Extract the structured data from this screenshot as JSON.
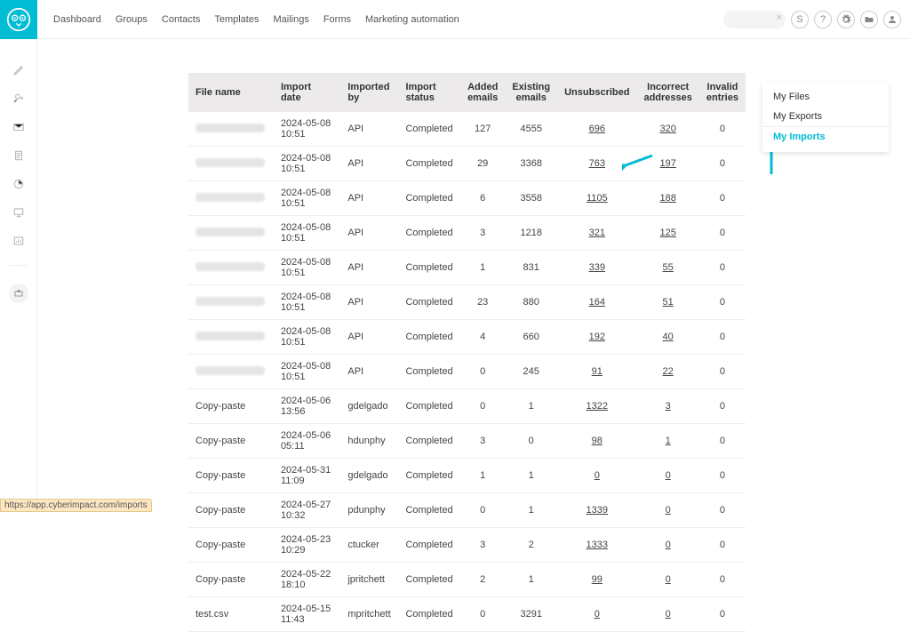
{
  "nav": [
    "Dashboard",
    "Groups",
    "Contacts",
    "Templates",
    "Mailings",
    "Forms",
    "Marketing automation"
  ],
  "files_menu": {
    "files": "My Files",
    "exports": "My Exports",
    "imports": "My Imports"
  },
  "columns": {
    "file_name": "File name",
    "import_date": "Import date",
    "imported_by": "Imported by",
    "import_status": "Import status",
    "added": "Added emails",
    "existing": "Existing emails",
    "unsub": "Unsubscribed",
    "incorrect": "Incorrect addresses",
    "invalid": "Invalid entries"
  },
  "rows": [
    {
      "file": "_blur",
      "date": "2024-05-08 10:51",
      "by": "API",
      "status": "Completed",
      "added": "127",
      "existing": "4555",
      "unsub": "696",
      "inc": "320",
      "inv": "0"
    },
    {
      "file": "_blur",
      "date": "2024-05-08 10:51",
      "by": "API",
      "status": "Completed",
      "added": "29",
      "existing": "3368",
      "unsub": "763",
      "inc": "197",
      "inv": "0"
    },
    {
      "file": "_blur",
      "date": "2024-05-08 10:51",
      "by": "API",
      "status": "Completed",
      "added": "6",
      "existing": "3558",
      "unsub": "1105",
      "inc": "188",
      "inv": "0"
    },
    {
      "file": "_blur",
      "date": "2024-05-08 10:51",
      "by": "API",
      "status": "Completed",
      "added": "3",
      "existing": "1218",
      "unsub": "321",
      "inc": "125",
      "inv": "0"
    },
    {
      "file": "_blur",
      "date": "2024-05-08 10:51",
      "by": "API",
      "status": "Completed",
      "added": "1",
      "existing": "831",
      "unsub": "339",
      "inc": "55",
      "inv": "0"
    },
    {
      "file": "_blur",
      "date": "2024-05-08 10:51",
      "by": "API",
      "status": "Completed",
      "added": "23",
      "existing": "880",
      "unsub": "164",
      "inc": "51",
      "inv": "0"
    },
    {
      "file": "_blur",
      "date": "2024-05-08 10:51",
      "by": "API",
      "status": "Completed",
      "added": "4",
      "existing": "660",
      "unsub": "192",
      "inc": "40",
      "inv": "0"
    },
    {
      "file": "_blur",
      "date": "2024-05-08 10:51",
      "by": "API",
      "status": "Completed",
      "added": "0",
      "existing": "245",
      "unsub": "91",
      "inc": "22",
      "inv": "0"
    },
    {
      "file": "Copy-paste",
      "date": "2024-05-06 13:56",
      "by": "gdelgado",
      "status": "Completed",
      "added": "0",
      "existing": "1",
      "unsub": "1322",
      "inc": "3",
      "inv": "0"
    },
    {
      "file": "Copy-paste",
      "date": "2024-05-06 05:11",
      "by": "hdunphy",
      "status": "Completed",
      "added": "3",
      "existing": "0",
      "unsub": "98",
      "inc": "1",
      "inv": "0"
    },
    {
      "file": "Copy-paste",
      "date": "2024-05-31 11:09",
      "by": "gdelgado",
      "status": "Completed",
      "added": "1",
      "existing": "1",
      "unsub": "0",
      "inc": "0",
      "inv": "0"
    },
    {
      "file": "Copy-paste",
      "date": "2024-05-27 10:32",
      "by": "pdunphy",
      "status": "Completed",
      "added": "0",
      "existing": "1",
      "unsub": "1339",
      "inc": "0",
      "inv": "0"
    },
    {
      "file": "Copy-paste",
      "date": "2024-05-23 10:29",
      "by": "ctucker",
      "status": "Completed",
      "added": "3",
      "existing": "2",
      "unsub": "1333",
      "inc": "0",
      "inv": "0"
    },
    {
      "file": "Copy-paste",
      "date": "2024-05-22 18:10",
      "by": "jpritchett",
      "status": "Completed",
      "added": "2",
      "existing": "1",
      "unsub": "99",
      "inc": "0",
      "inv": "0"
    },
    {
      "file": "test.csv",
      "date": "2024-05-15 11:43",
      "by": "mpritchett",
      "status": "Completed",
      "added": "0",
      "existing": "3291",
      "unsub": "0",
      "inc": "0",
      "inv": "0"
    }
  ],
  "url_hint": "https://app.cyberimpact.com/imports",
  "icons": {
    "currency": "S",
    "help": "?"
  }
}
